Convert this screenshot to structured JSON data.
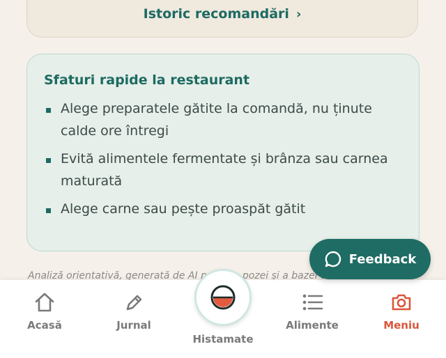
{
  "history": {
    "label": "Istoric recomandări",
    "chevron": "›"
  },
  "tips": {
    "title": "Sfaturi rapide la restaurant",
    "items": [
      {
        "line1": "Alege preparatele gătite la comandă, nu ținute",
        "line2": "calde ore întregi"
      },
      {
        "line1": "Evită alimentele fermentate și brânza sau carnea",
        "line2": "maturată"
      },
      {
        "line1": "Alege carne sau pește proaspăt gătit",
        "line2": ""
      }
    ]
  },
  "disclaimer": "Analiză orientativă, generată de AI pe baza pozei și a bazei de date",
  "feedback": {
    "label": "Feedback"
  },
  "nav": {
    "home": "Acasă",
    "journal": "Jurnal",
    "center": "Histamate",
    "foods": "Alimente",
    "menu": "Meniu"
  },
  "colors": {
    "accent": "#1f6c64",
    "active": "#d9573b"
  }
}
